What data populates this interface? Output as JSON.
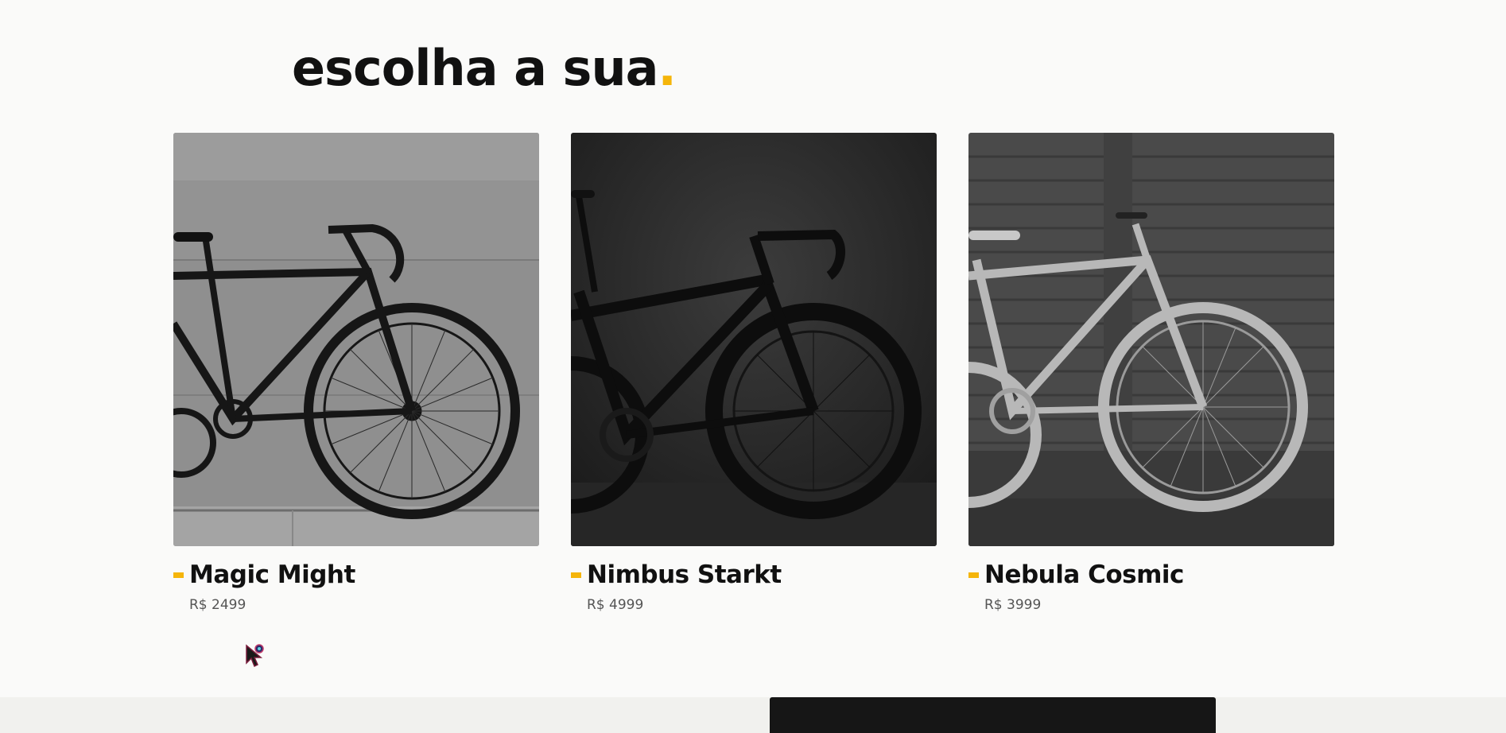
{
  "section": {
    "heading": "escolha a sua",
    "heading_accent": ".",
    "accent_color": "#f5b50a"
  },
  "products": [
    {
      "name": "Magic Might",
      "price": "R$ 2499",
      "image": "black-fixie-bike-photo"
    },
    {
      "name": "Nimbus Starkt",
      "price": "R$ 4999",
      "image": "dark-road-bike-photo"
    },
    {
      "name": "Nebula Cosmic",
      "price": "R$ 3999",
      "image": "white-fixie-bike-photo"
    }
  ]
}
